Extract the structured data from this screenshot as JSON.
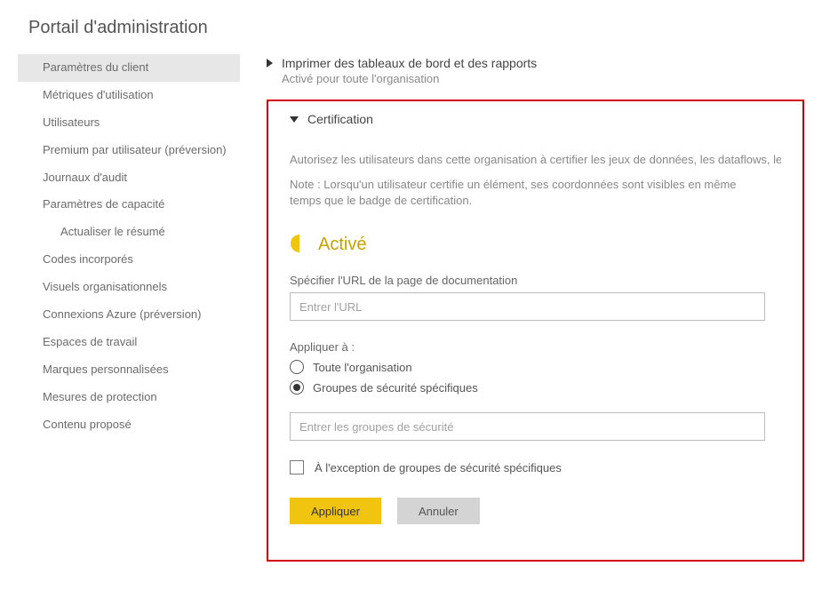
{
  "pageTitle": "Portail d'administration",
  "sidebar": {
    "items": [
      {
        "label": "Paramètres du client",
        "active": true
      },
      {
        "label": "Métriques d'utilisation"
      },
      {
        "label": "Utilisateurs"
      },
      {
        "label": "Premium par utilisateur (préversion)"
      },
      {
        "label": "Journaux d'audit"
      },
      {
        "label": "Paramètres de capacité"
      },
      {
        "label": "Actualiser le résumé",
        "indent": true
      },
      {
        "label": "Codes incorporés"
      },
      {
        "label": "Visuels organisationnels"
      },
      {
        "label": "Connexions Azure (préversion)"
      },
      {
        "label": "Espaces de travail"
      },
      {
        "label": "Marques personnalisées"
      },
      {
        "label": "Mesures de protection"
      },
      {
        "label": "Contenu proposé"
      }
    ]
  },
  "collapsedSection": {
    "title": "Imprimer des tableaux de bord et des rapports",
    "subtitle": "Activé pour toute l'organisation"
  },
  "certification": {
    "title": "Certification",
    "description": "Autorisez les utilisateurs dans cette organisation à certifier les jeux de données, les dataflows, les ra",
    "note": "Note : Lorsqu'un utilisateur certifie un élément, ses coordonnées sont visibles en même temps que le badge de certification.",
    "toggleLabel": "Activé",
    "urlLabel": "Spécifier l'URL de la page de documentation",
    "urlPlaceholder": "Entrer l'URL",
    "applyToLabel": "Appliquer à :",
    "radioAll": "Toute l'organisation",
    "radioGroups": "Groupes de sécurité spécifiques",
    "groupsPlaceholder": "Entrer les groupes de sécurité",
    "exceptLabel": "À l'exception de groupes de sécurité spécifiques",
    "applyButton": "Appliquer",
    "cancelButton": "Annuler"
  }
}
